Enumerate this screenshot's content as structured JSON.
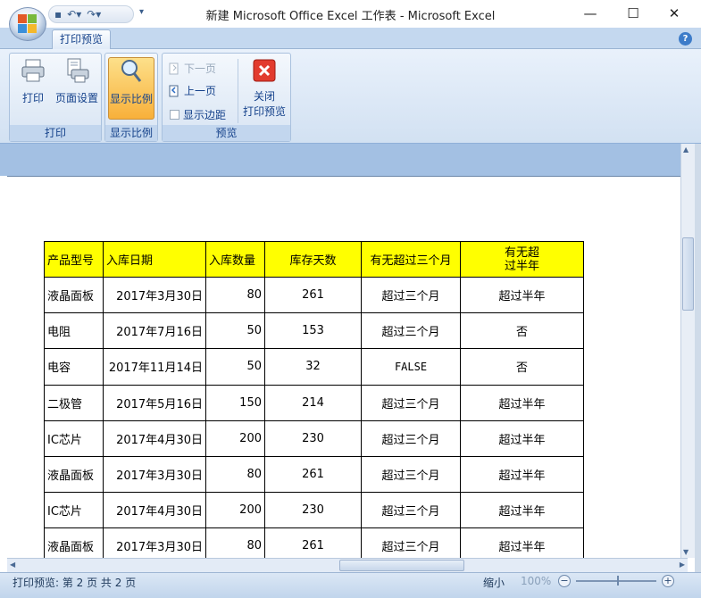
{
  "window": {
    "title": "新建 Microsoft Office Excel 工作表 - Microsoft Excel",
    "minimize": "—",
    "maximize": "☐",
    "close": "✕"
  },
  "ribbon": {
    "tab": "打印预览",
    "groups": {
      "print": {
        "label": "打印",
        "print_button": "打印",
        "page_setup_button": "页面设置"
      },
      "zoom": {
        "label": "显示比例",
        "zoom_button": "显示比例"
      },
      "preview": {
        "label": "预览",
        "next_page": "下一页",
        "prev_page": "上一页",
        "show_margins": "显示边距",
        "close_preview_line1": "关闭",
        "close_preview_line2": "打印预览"
      }
    }
  },
  "sheet": {
    "headers": [
      "产品型号",
      "入库日期",
      "入库数量",
      "库存天数",
      "有无超过三个月",
      "有无超\n过半年"
    ],
    "rows": [
      [
        "液晶面板",
        "2017年3月30日",
        "80",
        "261",
        "超过三个月",
        "超过半年"
      ],
      [
        "电阻",
        "2017年7月16日",
        "50",
        "153",
        "超过三个月",
        "否"
      ],
      [
        "电容",
        "2017年11月14日",
        "50",
        "32",
        "FALSE",
        "否"
      ],
      [
        "二极管",
        "2017年5月16日",
        "150",
        "214",
        "超过三个月",
        "超过半年"
      ],
      [
        "IC芯片",
        "2017年4月30日",
        "200",
        "230",
        "超过三个月",
        "超过半年"
      ],
      [
        "液晶面板",
        "2017年3月30日",
        "80",
        "261",
        "超过三个月",
        "超过半年"
      ],
      [
        "IC芯片",
        "2017年4月30日",
        "200",
        "230",
        "超过三个月",
        "超过半年"
      ],
      [
        "液晶面板",
        "2017年3月30日",
        "80",
        "261",
        "超过三个月",
        "超过半年"
      ]
    ]
  },
  "status": {
    "text": "打印预览: 第 2 页 共 2 页",
    "zoom_label": "缩小",
    "zoom_pct": "100%"
  }
}
